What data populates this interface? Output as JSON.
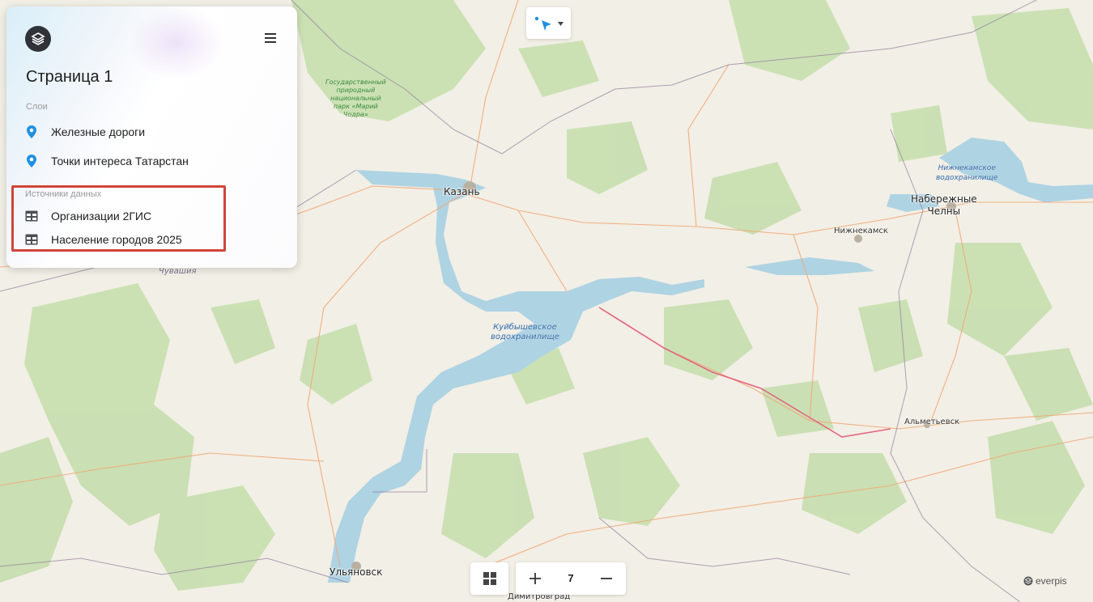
{
  "panel": {
    "page_title": "Страница 1",
    "layers_label": "Слои",
    "layers": [
      {
        "label": "Железные дороги",
        "icon": "map-pin-icon"
      },
      {
        "label": "Точки интереса Татарстан",
        "icon": "map-pin-icon"
      }
    ],
    "sources_label": "Источники данных",
    "sources": [
      {
        "label": "Организации 2ГИС",
        "icon": "table-icon"
      },
      {
        "label": "Население городов 2025",
        "icon": "table-icon"
      }
    ],
    "highlight_color": "#d0453a",
    "accent_color": "#1e90e0"
  },
  "map": {
    "labels": {
      "kazan": "Казань",
      "chelny_1": "Набережные",
      "chelny_2": "Челны",
      "nizhnekamsk": "Нижнекамск",
      "almetyevsk": "Альметьевск",
      "ulyanovsk": "Ульяновск",
      "dimitrovgrad": "Димитровград",
      "chuvashia": "Чувашия",
      "reservoir_1": "Куйбышевское",
      "reservoir_2": "водохранилище",
      "nk_reservoir_1": "Нижнекамское",
      "nk_reservoir_2": "водохранилище",
      "park_1": "Государственный",
      "park_2": "природный",
      "park_3": "национальный",
      "park_4": "парк «Марий",
      "park_5": "Чодра»"
    }
  },
  "controls": {
    "zoom_level": "7",
    "attribution": "everpis"
  }
}
